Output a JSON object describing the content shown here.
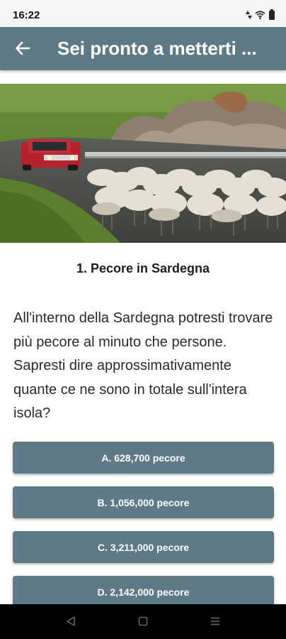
{
  "status_bar": {
    "time": "16:22",
    "icons": [
      "data-arrows-icon",
      "wifi-icon",
      "battery-icon"
    ]
  },
  "app_bar": {
    "title": "Sei pronto a metterti ...",
    "back_icon": "arrow-back-icon"
  },
  "question": {
    "title": "1. Pecore in Sardegna",
    "text": "All'interno della Sardegna potresti trovare più pecore al minuto che persone. Sapresti dire approssimativamente quante ce ne sono in totale sull'intera isola?"
  },
  "answers": [
    {
      "label": "A. 628,700 pecore"
    },
    {
      "label": "B. 1,056,000 pecore"
    },
    {
      "label": "C. 3,211,000 pecore"
    },
    {
      "label": "D. 2,142,000 pecore"
    }
  ],
  "nav_bar": {
    "icons": [
      "back-triangle-icon",
      "home-square-icon",
      "menu-icon"
    ]
  },
  "colors": {
    "primary": "#5f7a87",
    "status_bar": "#f5f5f5",
    "nav_bar": "#000000"
  }
}
